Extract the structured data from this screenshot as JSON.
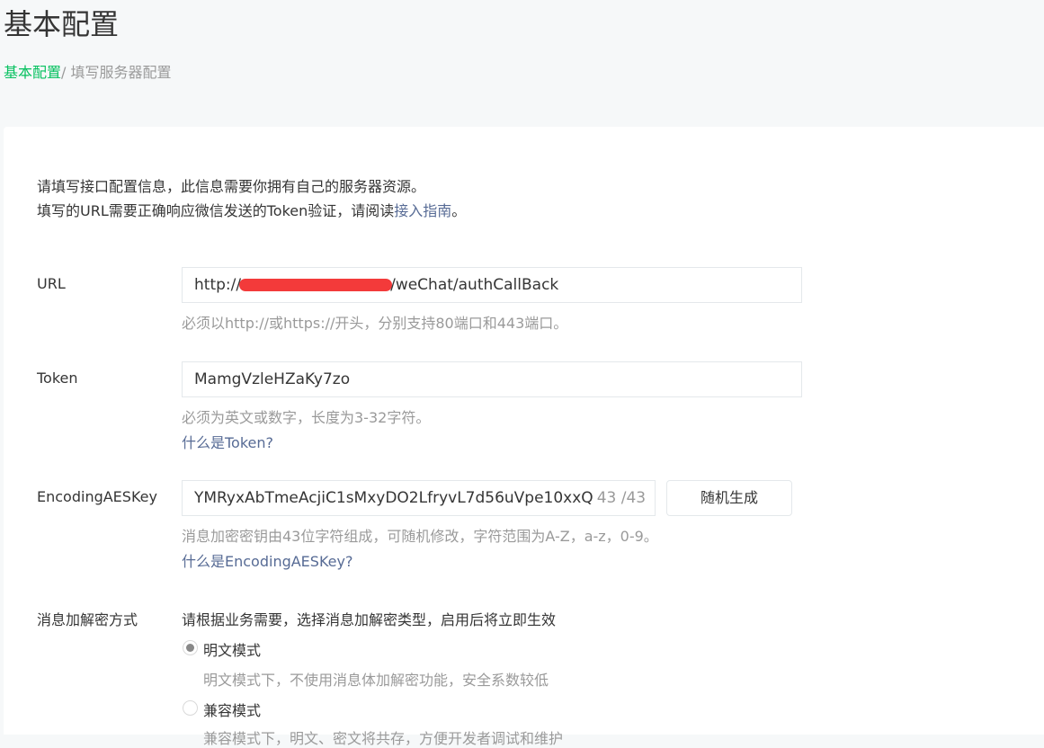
{
  "page_title": "基本配置",
  "breadcrumb": {
    "home": "基本配置",
    "separator": "/ ",
    "current": "填写服务器配置"
  },
  "intro": {
    "line1": "请填写接口配置信息，此信息需要你拥有自己的服务器资源。",
    "line2_prefix": "填写的URL需要正确响应微信发送的Token验证，请阅读",
    "line2_link": "接入指南",
    "line2_suffix": "。"
  },
  "url": {
    "label": "URL",
    "value_prefix": "http://",
    "value_suffix": "/weChat/authCallBack",
    "hint": "必须以http://或https://开头，分别支持80端口和443端口。"
  },
  "token": {
    "label": "Token",
    "value": "MamgVzleHZaKy7zo",
    "hint": "必须为英文或数字，长度为3-32字符。",
    "help_link": "什么是Token?"
  },
  "aes": {
    "label": "EncodingAESKey",
    "value": "YMRyxAbTmeAcjiC1sMxyDO2LfryvL7d56uVpe10xxQ",
    "count": "43 /43",
    "generate_button": "随机生成",
    "hint": "消息加密密钥由43位字符组成，可随机修改，字符范围为A-Z，a-z，0-9。",
    "help_link": "什么是EncodingAESKey?"
  },
  "encryption": {
    "label": "消息加解密方式",
    "description": "请根据业务需要，选择消息加解密类型，启用后将立即生效",
    "options": [
      {
        "label": "明文模式",
        "desc": "明文模式下，不使用消息体加解密功能，安全系数较低",
        "selected": true
      },
      {
        "label": "兼容模式",
        "desc": "兼容模式下，明文、密文将共存，方便开发者调试和维护",
        "selected": false
      }
    ]
  },
  "colors": {
    "accent": "#07c160",
    "link": "#576b95",
    "redaction": "#f33a3a"
  }
}
